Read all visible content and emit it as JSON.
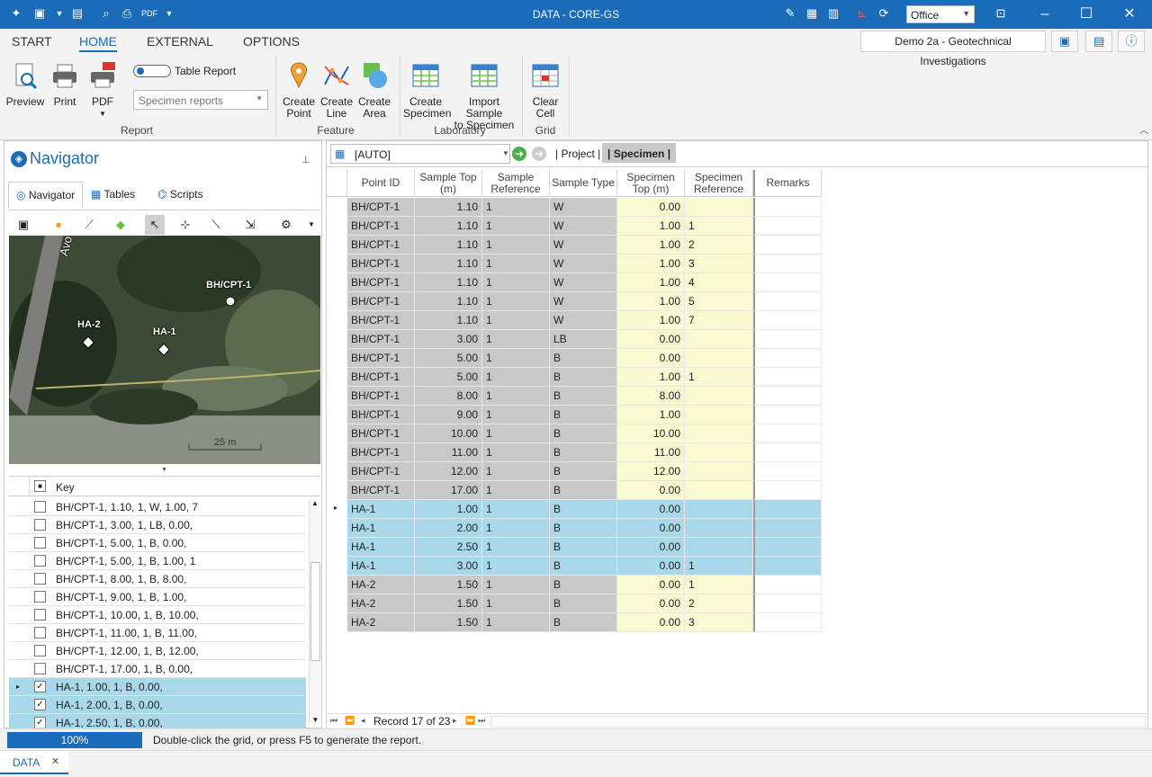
{
  "window": {
    "title": "DATA - CORE-GS",
    "office_value": "Office"
  },
  "ribbon": {
    "tabs": [
      "START",
      "HOME",
      "EXTERNAL",
      "OPTIONS"
    ],
    "active_tab": "HOME",
    "project_label": "Demo 2a - Geotechnical Investigations",
    "report": {
      "preview": "Preview",
      "print": "Print",
      "pdf": "PDF",
      "toggle_label": "Table Report",
      "select_value": "Specimen reports",
      "group": "Report"
    },
    "feature": {
      "create_point_1": "Create",
      "create_point_2": "Point",
      "create_line_1": "Create",
      "create_line_2": "Line",
      "create_area_1": "Create",
      "create_area_2": "Area",
      "group": "Feature"
    },
    "laboratory": {
      "create_specimen_1": "Create",
      "create_specimen_2": "Specimen",
      "import_1": "Import Sample",
      "import_2": "to Specimen",
      "group": "Laboratory"
    },
    "grid": {
      "clear_1": "Clear",
      "clear_2": "Cell",
      "group": "Grid"
    }
  },
  "navigator": {
    "title": "Navigator",
    "tabs": [
      "Navigator",
      "Tables",
      "Scripts"
    ],
    "map": {
      "labels": [
        "BH/CPT-1",
        "HA-2",
        "HA-1"
      ],
      "road": "Avo",
      "scale": "25 m"
    },
    "key_header": "Key",
    "keys": [
      {
        "text": "BH/CPT-1, 1.10, 1, W, 1.00, 7",
        "checked": false
      },
      {
        "text": "BH/CPT-1, 3.00, 1, LB, 0.00,",
        "checked": false
      },
      {
        "text": "BH/CPT-1, 5.00, 1, B, 0.00,",
        "checked": false
      },
      {
        "text": "BH/CPT-1, 5.00, 1, B, 1.00, 1",
        "checked": false
      },
      {
        "text": "BH/CPT-1, 8.00, 1, B, 8.00,",
        "checked": false
      },
      {
        "text": "BH/CPT-1, 9.00, 1, B, 1.00,",
        "checked": false
      },
      {
        "text": "BH/CPT-1, 10.00, 1, B, 10.00,",
        "checked": false
      },
      {
        "text": "BH/CPT-1, 11.00, 1, B, 11.00,",
        "checked": false
      },
      {
        "text": "BH/CPT-1, 12.00, 1, B, 12.00,",
        "checked": false
      },
      {
        "text": "BH/CPT-1, 17.00, 1, B, 0.00,",
        "checked": false
      },
      {
        "text": "HA-1, 1.00, 1, B, 0.00,",
        "checked": true
      },
      {
        "text": "HA-1, 2.00, 1, B, 0.00,",
        "checked": true
      },
      {
        "text": "HA-1, 2.50, 1, B, 0.00,",
        "checked": true
      }
    ]
  },
  "grid": {
    "auto_value": "[AUTO]",
    "crumbs": [
      "| Project |",
      "| Specimen |"
    ],
    "headers": [
      "Point ID",
      "Sample Top (m)",
      "Sample Reference",
      "Sample Type",
      "Specimen Top (m)",
      "Specimen Reference",
      "Remarks"
    ],
    "rows": [
      [
        "BH/CPT-1",
        "1.10",
        "1",
        "W",
        "0.00",
        ""
      ],
      [
        "BH/CPT-1",
        "1.10",
        "1",
        "W",
        "1.00",
        "1"
      ],
      [
        "BH/CPT-1",
        "1.10",
        "1",
        "W",
        "1.00",
        "2"
      ],
      [
        "BH/CPT-1",
        "1.10",
        "1",
        "W",
        "1.00",
        "3"
      ],
      [
        "BH/CPT-1",
        "1.10",
        "1",
        "W",
        "1.00",
        "4"
      ],
      [
        "BH/CPT-1",
        "1.10",
        "1",
        "W",
        "1.00",
        "5"
      ],
      [
        "BH/CPT-1",
        "1.10",
        "1",
        "W",
        "1.00",
        "7"
      ],
      [
        "BH/CPT-1",
        "3.00",
        "1",
        "LB",
        "0.00",
        ""
      ],
      [
        "BH/CPT-1",
        "5.00",
        "1",
        "B",
        "0.00",
        ""
      ],
      [
        "BH/CPT-1",
        "5.00",
        "1",
        "B",
        "1.00",
        "1"
      ],
      [
        "BH/CPT-1",
        "8.00",
        "1",
        "B",
        "8.00",
        ""
      ],
      [
        "BH/CPT-1",
        "9.00",
        "1",
        "B",
        "1.00",
        ""
      ],
      [
        "BH/CPT-1",
        "10.00",
        "1",
        "B",
        "10.00",
        ""
      ],
      [
        "BH/CPT-1",
        "11.00",
        "1",
        "B",
        "11.00",
        ""
      ],
      [
        "BH/CPT-1",
        "12.00",
        "1",
        "B",
        "12.00",
        ""
      ],
      [
        "BH/CPT-1",
        "17.00",
        "1",
        "B",
        "0.00",
        ""
      ],
      [
        "HA-1",
        "1.00",
        "1",
        "B",
        "0.00",
        ""
      ],
      [
        "HA-1",
        "2.00",
        "1",
        "B",
        "0.00",
        ""
      ],
      [
        "HA-1",
        "2.50",
        "1",
        "B",
        "0.00",
        ""
      ],
      [
        "HA-1",
        "3.00",
        "1",
        "B",
        "0.00",
        "1"
      ],
      [
        "HA-2",
        "1.50",
        "1",
        "B",
        "0.00",
        "1"
      ],
      [
        "HA-2",
        "1.50",
        "1",
        "B",
        "0.00",
        "2"
      ],
      [
        "HA-2",
        "1.50",
        "1",
        "B",
        "0.00",
        "3"
      ]
    ],
    "selected_rows": [
      16,
      17,
      18,
      19
    ],
    "record_label": "Record 17 of 23"
  },
  "status": {
    "progress": "100%",
    "message": "Double-click the grid, or press F5 to generate the report."
  },
  "doc_tab": "DATA",
  "colors": {
    "accent": "#1a6bb8",
    "selected": "#a8d8ea",
    "key_cell": "#c8c8c8",
    "editable": "#fafad2"
  }
}
